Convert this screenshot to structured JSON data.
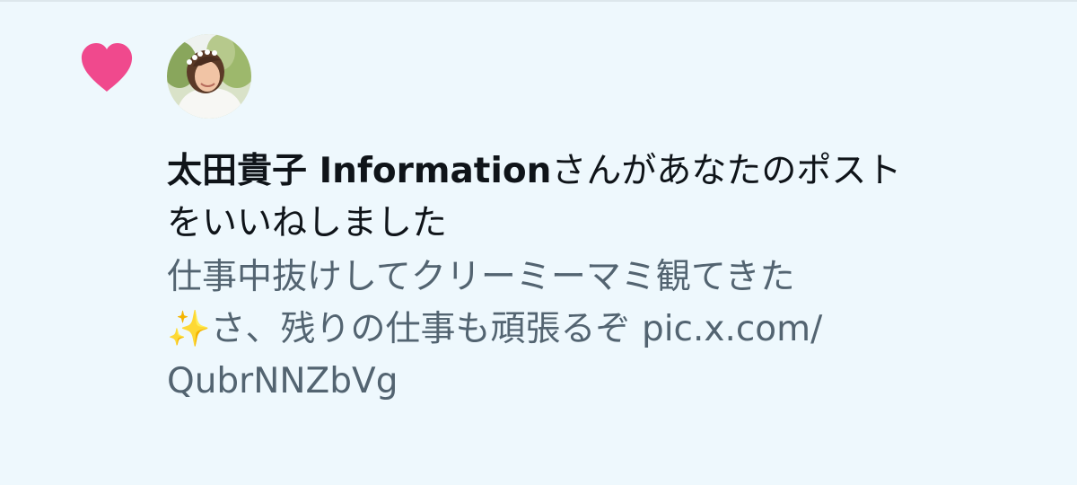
{
  "notification": {
    "type_icon": "heart-icon",
    "accent_color": "#f0498d",
    "avatar_alt": "user-avatar",
    "user_name": "太田貴子 Information",
    "action_text_line1": "さんがあなたのポスト",
    "action_text_line2": "をいいねしました",
    "post_text_line1": "仕事中抜けしてクリーミーマミ観てきた",
    "post_text_line2": "✨さ、残りの仕事も頑張るぞ pic.x.com/",
    "post_text_line3": "QubrNNZbVg"
  },
  "colors": {
    "background": "#eef8fd",
    "primary_text": "#0f1419",
    "secondary_text": "#536471",
    "heart": "#f0498d"
  }
}
